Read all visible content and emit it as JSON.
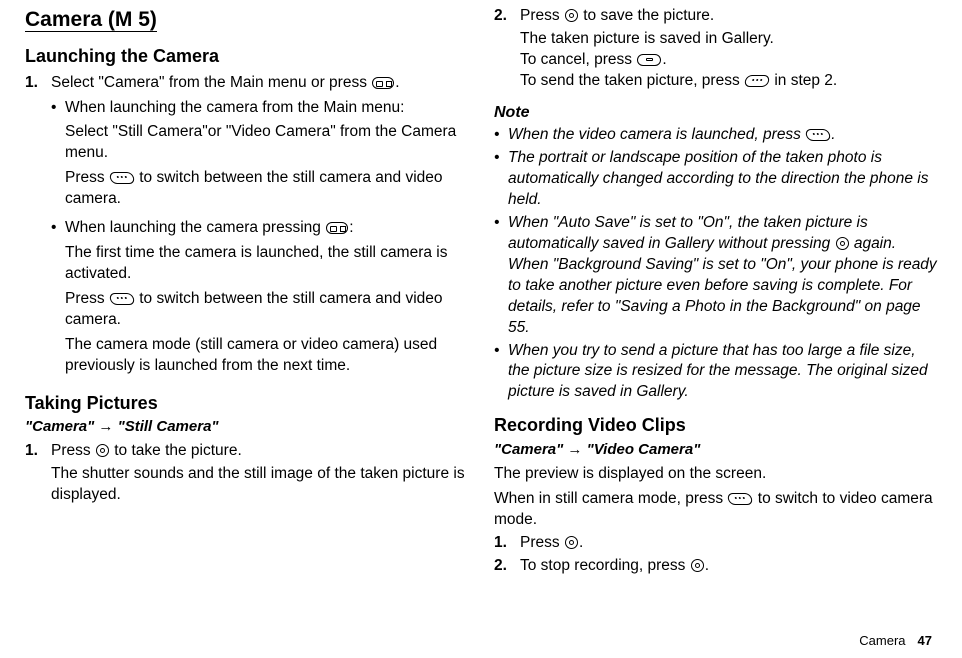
{
  "page": {
    "section": "Camera",
    "number": "47"
  },
  "left": {
    "title_a": "Camera",
    "title_b": " (M 5)",
    "h_launch": "Launching the Camera",
    "s1_num": "1.",
    "s1_a": "Select \"Camera\" from the Main menu or press ",
    "s1_b": ".",
    "b1_a": "When launching the camera from the Main menu:",
    "b1_b": "Select \"Still Camera\"or \"Video Camera\" from the Camera menu.",
    "b1_c_a": "Press ",
    "b1_c_b": " to switch between the still camera and video camera.",
    "b2_a": "When launching the camera pressing ",
    "b2_a2": ":",
    "b2_b": "The first time the camera is launched, the still camera is activated.",
    "b2_c_a": "Press ",
    "b2_c_b": " to switch between the still camera and video camera.",
    "b2_d": "The camera mode (still camera or video camera) used previously is launched from the next time.",
    "h_take": "Taking Pictures",
    "bc_take": "\"Camera\" → \"Still Camera\"",
    "t1_num": "1.",
    "t1_a": "Press ",
    "t1_b": " to take the picture.",
    "t1_c": "The shutter sounds and the still image of the taken picture is displayed."
  },
  "right": {
    "t2_num": "2.",
    "t2_a": "Press ",
    "t2_b": " to save the picture.",
    "t2_c": "The taken picture is saved in Gallery.",
    "t2_d_a": "To cancel, press ",
    "t2_d_b": ".",
    "t2_e_a": "To send the taken picture, press ",
    "t2_e_b": " in step 2.",
    "note_hdr": "Note",
    "n1_a": "When the video camera is launched, press ",
    "n1_b": ".",
    "n2": "The portrait or landscape position of the taken photo is automatically changed according to the direction the phone is held.",
    "n3_a": "When \"Auto Save\" is set to \"On\", the taken picture is automatically saved in Gallery without pressing ",
    "n3_b": " again. When \"Background Saving\" is set to \"On\", your phone is ready to take another picture even before saving is complete. For details, refer to \"Saving a Photo in the Background\" on page 55.",
    "n4": "When you try to send a picture that has too large a file size, the picture size is resized for the message. The original sized picture is saved in Gallery.",
    "h_rec": "Recording Video Clips",
    "bc_rec": "\"Camera\" → \"Video Camera\"",
    "rec_p1": "The preview is displayed on the screen.",
    "rec_p2_a": "When in still camera mode, press ",
    "rec_p2_b": " to switch to video camera mode.",
    "r1_num": "1.",
    "r1_a": "Press ",
    "r1_b": ".",
    "r2_num": "2.",
    "r2_a": "To stop recording, press ",
    "r2_b": "."
  }
}
